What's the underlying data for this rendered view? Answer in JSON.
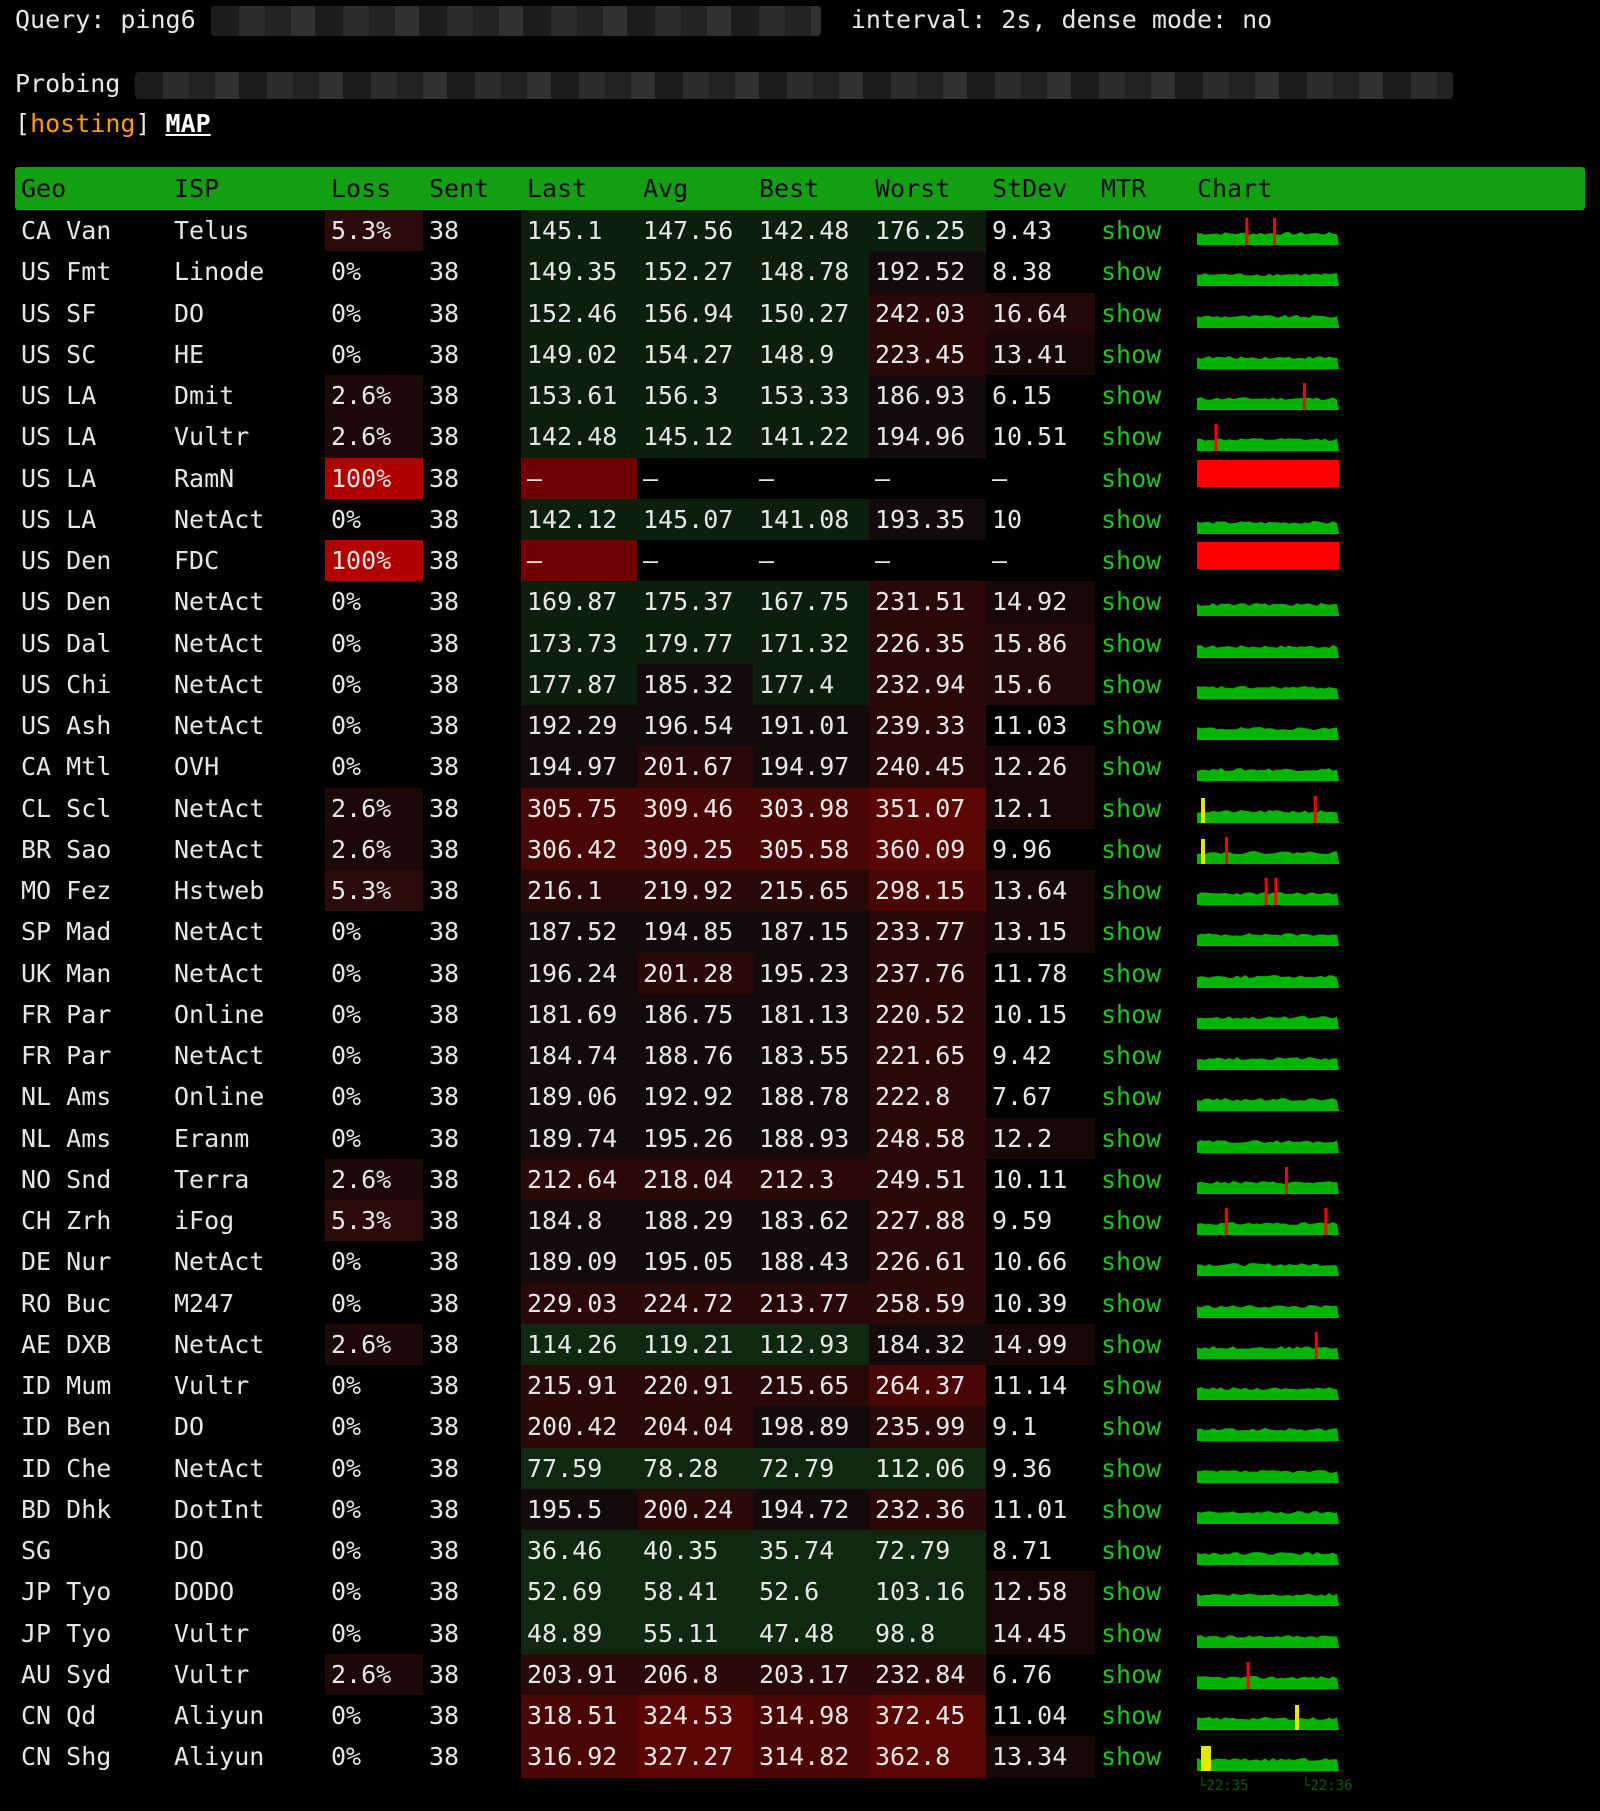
{
  "header": {
    "query_label": "Query: ping6",
    "settings": "interval: 2s, dense mode: no",
    "probing_label": "Probing",
    "tag": "hosting",
    "map_label": "MAP"
  },
  "columns": [
    "Geo",
    "ISP",
    "Loss",
    "Sent",
    "Last",
    "Avg",
    "Best",
    "Worst",
    "StDev",
    "MTR",
    "Chart"
  ],
  "mtr_label": "show",
  "colors": {
    "header_bg": "#12a012",
    "accent": "#ff9c00",
    "loss_full": "#b00000",
    "chart_green": "#00b400",
    "chart_red": "#ff0000",
    "chart_yellow": "#e6e600"
  },
  "rows": [
    {
      "geo": "CA Van",
      "isp": "Telus",
      "loss": "5.3%",
      "sent": "38",
      "last": "145.1",
      "avg": "147.56",
      "best": "142.48",
      "worst": "176.25",
      "stdev": "9.43"
    },
    {
      "geo": "US Fmt",
      "isp": "Linode",
      "loss": "0%",
      "sent": "38",
      "last": "149.35",
      "avg": "152.27",
      "best": "148.78",
      "worst": "192.52",
      "stdev": "8.38"
    },
    {
      "geo": "US SF",
      "isp": "DO",
      "loss": "0%",
      "sent": "38",
      "last": "152.46",
      "avg": "156.94",
      "best": "150.27",
      "worst": "242.03",
      "stdev": "16.64"
    },
    {
      "geo": "US SC",
      "isp": "HE",
      "loss": "0%",
      "sent": "38",
      "last": "149.02",
      "avg": "154.27",
      "best": "148.9",
      "worst": "223.45",
      "stdev": "13.41"
    },
    {
      "geo": "US LA",
      "isp": "Dmit",
      "loss": "2.6%",
      "sent": "38",
      "last": "153.61",
      "avg": "156.3",
      "best": "153.33",
      "worst": "186.93",
      "stdev": "6.15"
    },
    {
      "geo": "US LA",
      "isp": "Vultr",
      "loss": "2.6%",
      "sent": "38",
      "last": "142.48",
      "avg": "145.12",
      "best": "141.22",
      "worst": "194.96",
      "stdev": "10.51"
    },
    {
      "geo": "US LA",
      "isp": "RamN",
      "loss": "100%",
      "sent": "38",
      "last": "–",
      "avg": "–",
      "best": "–",
      "worst": "–",
      "stdev": "–"
    },
    {
      "geo": "US LA",
      "isp": "NetAct",
      "loss": "0%",
      "sent": "38",
      "last": "142.12",
      "avg": "145.07",
      "best": "141.08",
      "worst": "193.35",
      "stdev": "10"
    },
    {
      "geo": "US Den",
      "isp": "FDC",
      "loss": "100%",
      "sent": "38",
      "last": "–",
      "avg": "–",
      "best": "–",
      "worst": "–",
      "stdev": "–"
    },
    {
      "geo": "US Den",
      "isp": "NetAct",
      "loss": "0%",
      "sent": "38",
      "last": "169.87",
      "avg": "175.37",
      "best": "167.75",
      "worst": "231.51",
      "stdev": "14.92"
    },
    {
      "geo": "US Dal",
      "isp": "NetAct",
      "loss": "0%",
      "sent": "38",
      "last": "173.73",
      "avg": "179.77",
      "best": "171.32",
      "worst": "226.35",
      "stdev": "15.86"
    },
    {
      "geo": "US Chi",
      "isp": "NetAct",
      "loss": "0%",
      "sent": "38",
      "last": "177.87",
      "avg": "185.32",
      "best": "177.4",
      "worst": "232.94",
      "stdev": "15.6"
    },
    {
      "geo": "US Ash",
      "isp": "NetAct",
      "loss": "0%",
      "sent": "38",
      "last": "192.29",
      "avg": "196.54",
      "best": "191.01",
      "worst": "239.33",
      "stdev": "11.03"
    },
    {
      "geo": "CA Mtl",
      "isp": "OVH",
      "loss": "0%",
      "sent": "38",
      "last": "194.97",
      "avg": "201.67",
      "best": "194.97",
      "worst": "240.45",
      "stdev": "12.26"
    },
    {
      "geo": "CL Scl",
      "isp": "NetAct",
      "loss": "2.6%",
      "sent": "38",
      "last": "305.75",
      "avg": "309.46",
      "best": "303.98",
      "worst": "351.07",
      "stdev": "12.1"
    },
    {
      "geo": "BR Sao",
      "isp": "NetAct",
      "loss": "2.6%",
      "sent": "38",
      "last": "306.42",
      "avg": "309.25",
      "best": "305.58",
      "worst": "360.09",
      "stdev": "9.96"
    },
    {
      "geo": "MO Fez",
      "isp": "Hstweb",
      "loss": "5.3%",
      "sent": "38",
      "last": "216.1",
      "avg": "219.92",
      "best": "215.65",
      "worst": "298.15",
      "stdev": "13.64"
    },
    {
      "geo": "SP Mad",
      "isp": "NetAct",
      "loss": "0%",
      "sent": "38",
      "last": "187.52",
      "avg": "194.85",
      "best": "187.15",
      "worst": "233.77",
      "stdev": "13.15"
    },
    {
      "geo": "UK Man",
      "isp": "NetAct",
      "loss": "0%",
      "sent": "38",
      "last": "196.24",
      "avg": "201.28",
      "best": "195.23",
      "worst": "237.76",
      "stdev": "11.78"
    },
    {
      "geo": "FR Par",
      "isp": "Online",
      "loss": "0%",
      "sent": "38",
      "last": "181.69",
      "avg": "186.75",
      "best": "181.13",
      "worst": "220.52",
      "stdev": "10.15"
    },
    {
      "geo": "FR Par",
      "isp": "NetAct",
      "loss": "0%",
      "sent": "38",
      "last": "184.74",
      "avg": "188.76",
      "best": "183.55",
      "worst": "221.65",
      "stdev": "9.42"
    },
    {
      "geo": "NL Ams",
      "isp": "Online",
      "loss": "0%",
      "sent": "38",
      "last": "189.06",
      "avg": "192.92",
      "best": "188.78",
      "worst": "222.8",
      "stdev": "7.67"
    },
    {
      "geo": "NL Ams",
      "isp": "Eranm",
      "loss": "0%",
      "sent": "38",
      "last": "189.74",
      "avg": "195.26",
      "best": "188.93",
      "worst": "248.58",
      "stdev": "12.2"
    },
    {
      "geo": "NO Snd",
      "isp": "Terra",
      "loss": "2.6%",
      "sent": "38",
      "last": "212.64",
      "avg": "218.04",
      "best": "212.3",
      "worst": "249.51",
      "stdev": "10.11"
    },
    {
      "geo": "CH Zrh",
      "isp": "iFog",
      "loss": "5.3%",
      "sent": "38",
      "last": "184.8",
      "avg": "188.29",
      "best": "183.62",
      "worst": "227.88",
      "stdev": "9.59"
    },
    {
      "geo": "DE Nur",
      "isp": "NetAct",
      "loss": "0%",
      "sent": "38",
      "last": "189.09",
      "avg": "195.05",
      "best": "188.43",
      "worst": "226.61",
      "stdev": "10.66"
    },
    {
      "geo": "RO Buc",
      "isp": "M247",
      "loss": "0%",
      "sent": "38",
      "last": "229.03",
      "avg": "224.72",
      "best": "213.77",
      "worst": "258.59",
      "stdev": "10.39"
    },
    {
      "geo": "AE DXB",
      "isp": "NetAct",
      "loss": "2.6%",
      "sent": "38",
      "last": "114.26",
      "avg": "119.21",
      "best": "112.93",
      "worst": "184.32",
      "stdev": "14.99"
    },
    {
      "geo": "ID Mum",
      "isp": "Vultr",
      "loss": "0%",
      "sent": "38",
      "last": "215.91",
      "avg": "220.91",
      "best": "215.65",
      "worst": "264.37",
      "stdev": "11.14"
    },
    {
      "geo": "ID Ben",
      "isp": "DO",
      "loss": "0%",
      "sent": "38",
      "last": "200.42",
      "avg": "204.04",
      "best": "198.89",
      "worst": "235.99",
      "stdev": "9.1"
    },
    {
      "geo": "ID Che",
      "isp": "NetAct",
      "loss": "0%",
      "sent": "38",
      "last": "77.59",
      "avg": "78.28",
      "best": "72.79",
      "worst": "112.06",
      "stdev": "9.36"
    },
    {
      "geo": "BD Dhk",
      "isp": "DotInt",
      "loss": "0%",
      "sent": "38",
      "last": "195.5",
      "avg": "200.24",
      "best": "194.72",
      "worst": "232.36",
      "stdev": "11.01"
    },
    {
      "geo": "SG",
      "isp": "DO",
      "loss": "0%",
      "sent": "38",
      "last": "36.46",
      "avg": "40.35",
      "best": "35.74",
      "worst": "72.79",
      "stdev": "8.71"
    },
    {
      "geo": "JP Tyo",
      "isp": "DODO",
      "loss": "0%",
      "sent": "38",
      "last": "52.69",
      "avg": "58.41",
      "best": "52.6",
      "worst": "103.16",
      "stdev": "12.58"
    },
    {
      "geo": "JP Tyo",
      "isp": "Vultr",
      "loss": "0%",
      "sent": "38",
      "last": "48.89",
      "avg": "55.11",
      "best": "47.48",
      "worst": "98.8",
      "stdev": "14.45"
    },
    {
      "geo": "AU Syd",
      "isp": "Vultr",
      "loss": "2.6%",
      "sent": "38",
      "last": "203.91",
      "avg": "206.8",
      "best": "203.17",
      "worst": "232.84",
      "stdev": "6.76"
    },
    {
      "geo": "CN Qd",
      "isp": "Aliyun",
      "loss": "0%",
      "sent": "38",
      "last": "318.51",
      "avg": "324.53",
      "best": "314.98",
      "worst": "372.45",
      "stdev": "11.04"
    },
    {
      "geo": "CN Shg",
      "isp": "Aliyun",
      "loss": "0%",
      "sent": "38",
      "last": "316.92",
      "avg": "327.27",
      "best": "314.82",
      "worst": "362.8",
      "stdev": "13.34"
    }
  ],
  "chart_axis": [
    "22:35",
    "22:36"
  ]
}
